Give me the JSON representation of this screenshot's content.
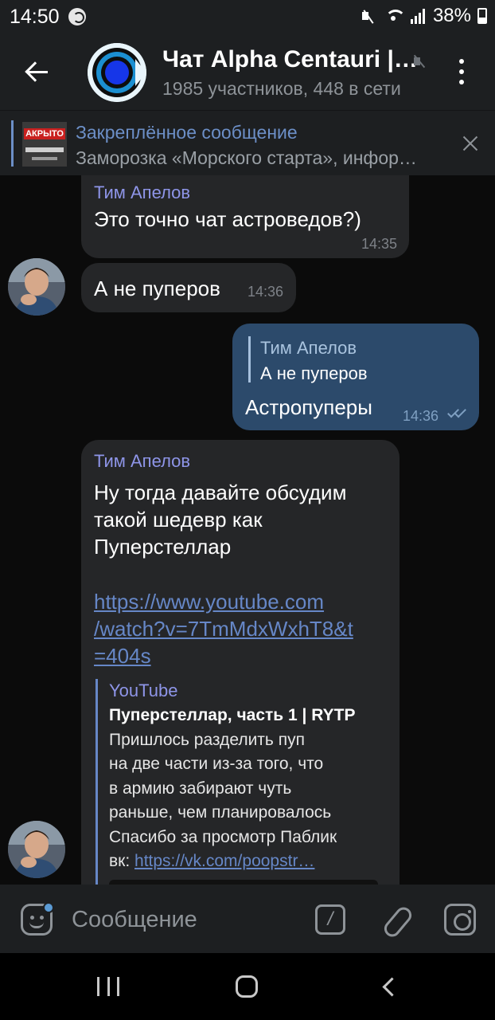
{
  "status_bar": {
    "time": "14:50",
    "battery_text": "38%",
    "icons": [
      "sync-icon",
      "mute-icon",
      "wifi-icon",
      "signal-icon",
      "battery-icon"
    ]
  },
  "header": {
    "title": "Чат Alpha Centauri |…",
    "subtitle": "1985 участников, 448 в сети",
    "avatar_colors": {
      "ring": "#1b8fd1",
      "center": "#1636e8",
      "outline": "#0d0d0d"
    }
  },
  "pinned": {
    "title": "Закреплённое сообщение",
    "text": "Заморозка «Морского старта», инфор…",
    "thumb_label": "АКРЫТО"
  },
  "messages": [
    {
      "sender": "Тим Апелов",
      "text": "Это точно чат астроведов?)",
      "time": "14:35"
    },
    {
      "text": "А не пуперов",
      "time": "14:36"
    },
    {
      "reply": {
        "name": "Тим Апелов",
        "text": "А не пуперов"
      },
      "text": "Астропуперы",
      "time": "14:36"
    },
    {
      "sender": "Тим Апелов",
      "text_lines": [
        "Ну тогда давайте обсудим",
        "такой шедевр как",
        "Пуперстеллар"
      ],
      "link_lines": [
        "https://www.youtube.com",
        "/watch?v=7TmMdxWxhT8&t",
        "=404s"
      ],
      "preview": {
        "site": "YouTube",
        "title": "Пуперстеллар, часть 1 | RYTP",
        "desc_lines": [
          "Пришлось разделить пуп",
          "на две части из-за того, что",
          "в армию забирают чуть",
          "раньше, чем планировалось",
          "Спасибо за просмотр Паблик"
        ],
        "desc_last_prefix": "вк: ",
        "desc_last_link": "https://vk.com/poopstr…"
      }
    }
  ],
  "input": {
    "placeholder": "Сообщение",
    "command_label": "/"
  },
  "colors": {
    "bubble_in": "#252628",
    "bubble_out": "#2c4a6b",
    "sender": "#8e95e8",
    "link": "#6687c7",
    "accent": "#6c8fc7"
  }
}
